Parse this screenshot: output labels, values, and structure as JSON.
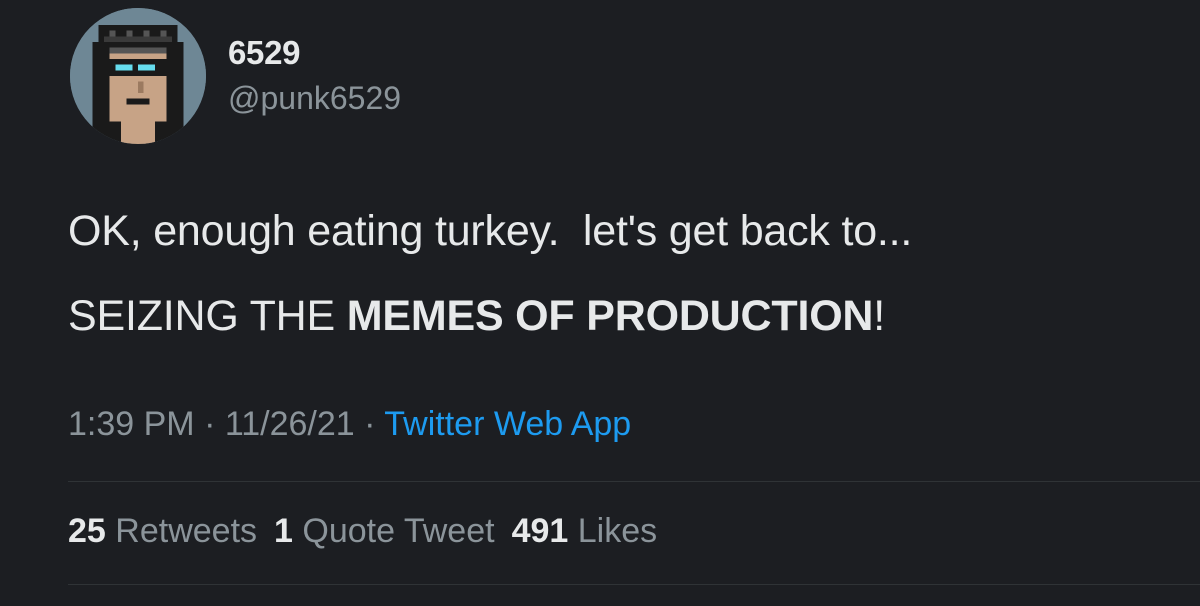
{
  "author": {
    "display_name": "6529",
    "handle": "@punk6529",
    "avatar": "pixel-punk-avatar"
  },
  "tweet": {
    "line1": "OK, enough eating turkey.  let's get back to...",
    "line2_prefix": "SEIZING THE ",
    "line2_bold": "MEMES OF PRODUCTION",
    "line2_suffix": "!"
  },
  "meta": {
    "time": "1:39 PM",
    "separator": " · ",
    "date": "11/26/21",
    "source": "Twitter Web App"
  },
  "stats": {
    "retweets_count": "25",
    "retweets_label": "Retweets",
    "quotes_count": "1",
    "quotes_label": "Quote Tweet",
    "likes_count": "491",
    "likes_label": "Likes"
  },
  "colors": {
    "background": "#1c1e22",
    "text": "#e7e9ea",
    "secondary": "#8b949a",
    "link": "#1d9bf0"
  }
}
